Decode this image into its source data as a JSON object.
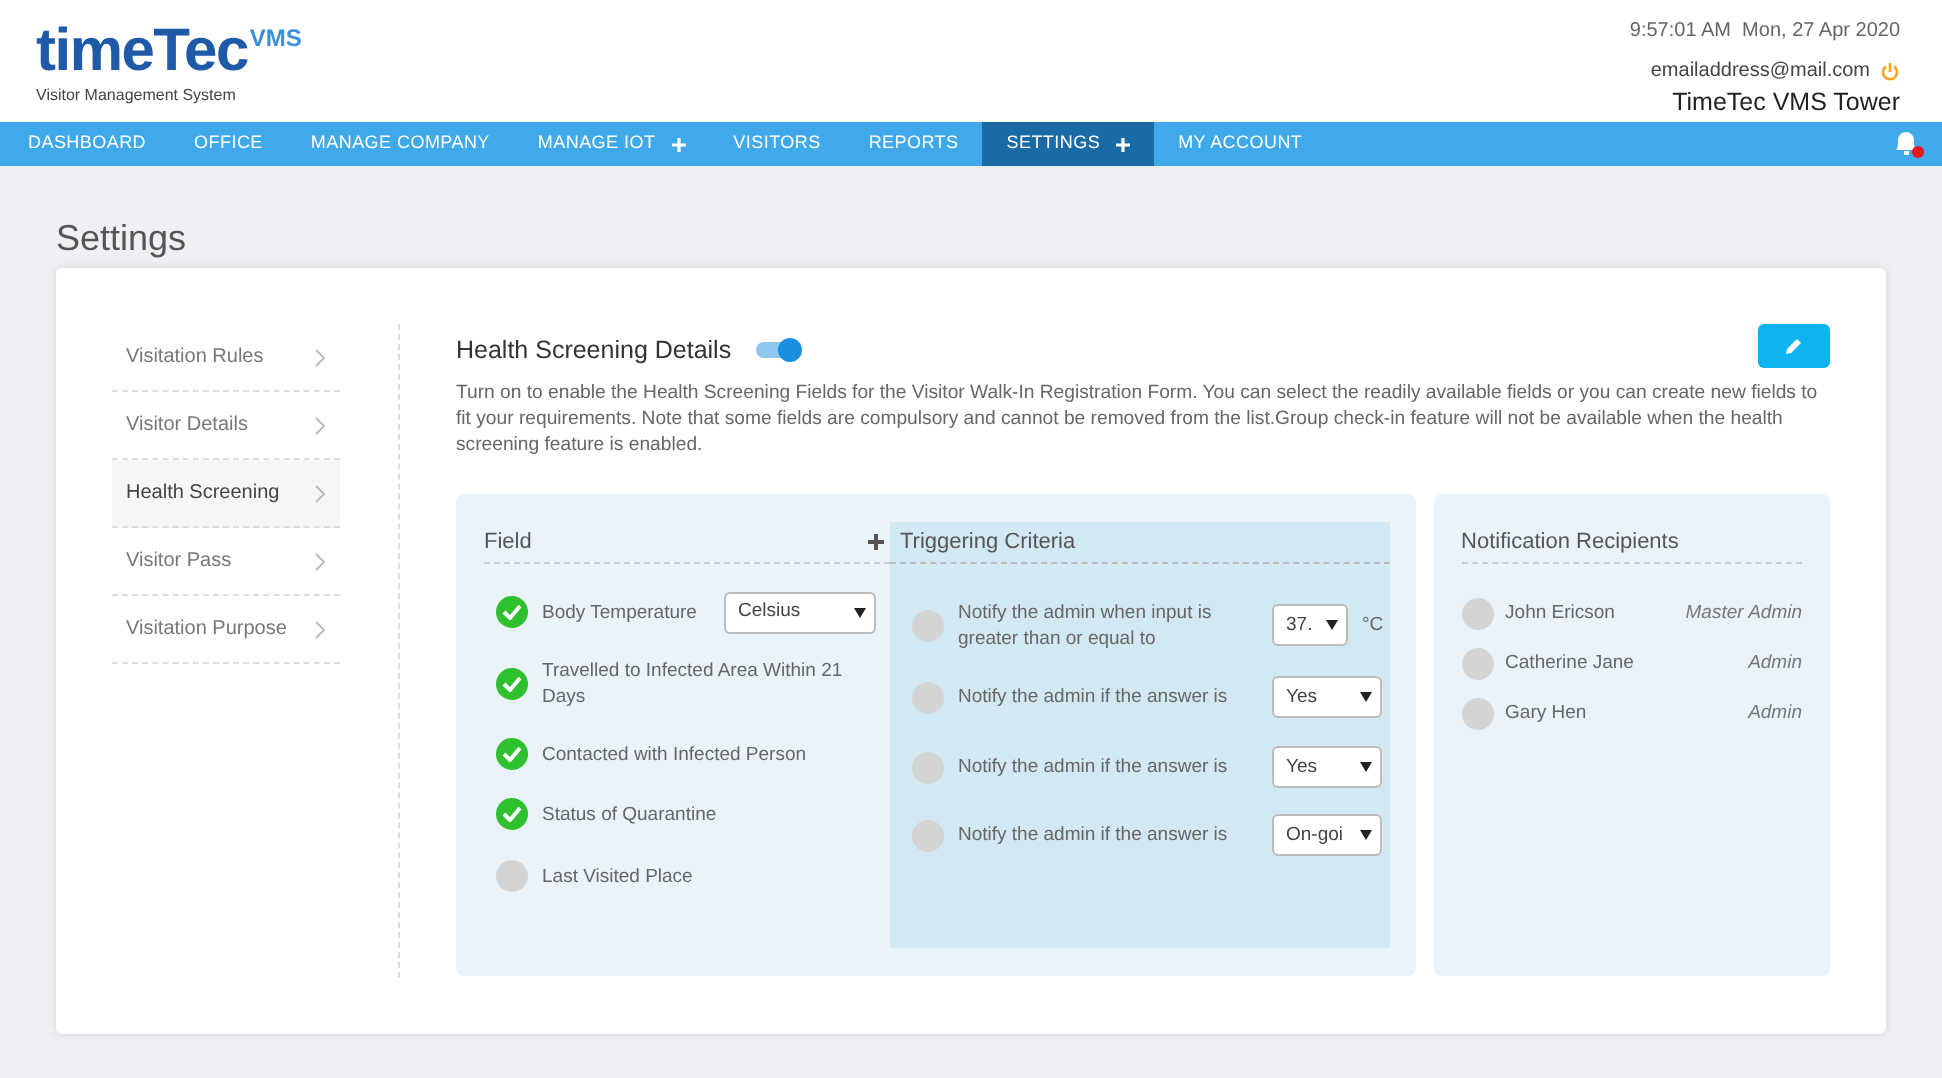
{
  "header": {
    "logo_text": "timeTec",
    "logo_badge": "VMS",
    "logo_subtitle": "Visitor Management System",
    "datetime": "9:57:01 AM  Mon, 27 Apr 2020",
    "email": "emailaddress@mail.com",
    "site": "TimeTec VMS Tower"
  },
  "nav": [
    {
      "label": "DASHBOARD",
      "selected": false,
      "has_plus": false
    },
    {
      "label": "OFFICE",
      "selected": false,
      "has_plus": false
    },
    {
      "label": "MANAGE COMPANY",
      "selected": false,
      "has_plus": false
    },
    {
      "label": "MANAGE IOT",
      "selected": false,
      "has_plus": true
    },
    {
      "label": "VISITORS",
      "selected": false,
      "has_plus": false
    },
    {
      "label": "REPORTS",
      "selected": false,
      "has_plus": false
    },
    {
      "label": "SETTINGS",
      "selected": true,
      "has_plus": true
    },
    {
      "label": "MY ACCOUNT",
      "selected": false,
      "has_plus": false
    }
  ],
  "page_title": "Settings",
  "sidebar": [
    {
      "label": "Visitation Rules",
      "selected": false
    },
    {
      "label": "Visitor Details",
      "selected": false
    },
    {
      "label": "Health Screening",
      "selected": true
    },
    {
      "label": "Visitor Pass",
      "selected": false
    },
    {
      "label": "Visitation Purpose",
      "selected": false
    }
  ],
  "section": {
    "title": "Health Screening Details",
    "enabled": true,
    "description": "Turn on to enable the Health Screening Fields for the Visitor Walk-In Registration Form. You can select the readily available fields or you can create new fields to fit your requirements. Note that some fields are compulsory and cannot be removed from the list.Group check-in feature will not be available when the health screening feature is enabled."
  },
  "fields_header": "Field",
  "fields": [
    {
      "label": "Body Temperature",
      "checked": true,
      "select": "Celsius"
    },
    {
      "label": "Travelled to Infected Area Within 21 Days",
      "checked": true
    },
    {
      "label": "Contacted with Infected Person",
      "checked": true
    },
    {
      "label": "Status of Quarantine",
      "checked": true
    },
    {
      "label": "Last Visited Place",
      "checked": false
    }
  ],
  "criteria_header": "Triggering Criteria",
  "criteria": [
    {
      "label": "Notify the admin when input is greater than or equal to",
      "checked": false,
      "select": "37.",
      "unit": "°C"
    },
    {
      "label": "Notify the admin if the answer is",
      "checked": false,
      "select": "Yes"
    },
    {
      "label": "Notify the admin if the answer is",
      "checked": false,
      "select": "Yes"
    },
    {
      "label": "Notify the admin if the answer is",
      "checked": false,
      "select": "On-goi"
    }
  ],
  "recipients_header": "Notification Recipients",
  "recipients": [
    {
      "name": "John Ericson",
      "role": "Master Admin",
      "checked": false
    },
    {
      "name": "Catherine Jane",
      "role": "Admin",
      "checked": false
    },
    {
      "name": "Gary Hen",
      "role": "Admin",
      "checked": false
    }
  ]
}
